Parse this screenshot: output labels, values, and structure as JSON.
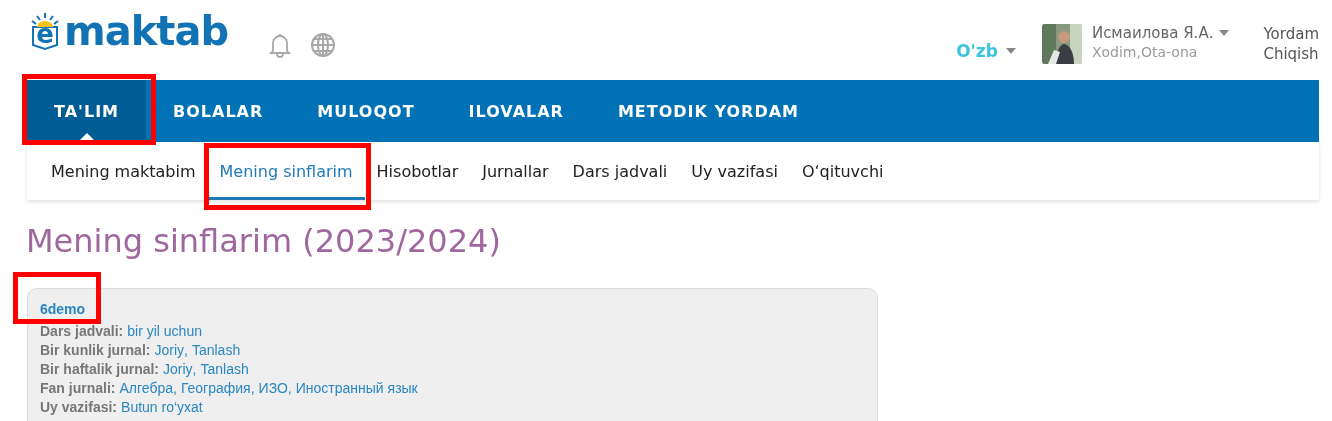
{
  "logo": {
    "letter": "e",
    "text": "maktab"
  },
  "header": {
    "language": "O'zb",
    "user": {
      "name": "Исмаилова Я.А.",
      "role": "Xodim,Ota-ona"
    },
    "links": [
      "Yordam",
      "Chiqish"
    ]
  },
  "nav": [
    {
      "label": "TA'LIM",
      "selected": true,
      "highlighted": true
    },
    {
      "label": "BOLALAR",
      "selected": false,
      "highlighted": false
    },
    {
      "label": "MULOQOT",
      "selected": false,
      "highlighted": false
    },
    {
      "label": "ILOVALAR",
      "selected": false,
      "highlighted": false
    },
    {
      "label": "METODIK YORDAM",
      "selected": false,
      "highlighted": false
    }
  ],
  "subnav": [
    {
      "label": "Mening maktabim",
      "selected": false,
      "highlighted": false
    },
    {
      "label": "Mening sinflarim",
      "selected": true,
      "highlighted": true
    },
    {
      "label": "Hisobotlar",
      "selected": false,
      "highlighted": false
    },
    {
      "label": "Jurnallar",
      "selected": false,
      "highlighted": false
    },
    {
      "label": "Dars jadvali",
      "selected": false,
      "highlighted": false
    },
    {
      "label": "Uy vazifasi",
      "selected": false,
      "highlighted": false
    },
    {
      "label": "O‘qituvchi",
      "selected": false,
      "highlighted": false
    }
  ],
  "page_title": "Mening sinflarim (2023/2024)",
  "class_card": {
    "name": "6demo",
    "highlighted": true,
    "separator": ",",
    "rows": [
      {
        "label": "Dars jadvali:",
        "links": [
          "bir yil uchun"
        ]
      },
      {
        "label": "Bir kunlik jurnal:",
        "links": [
          "Joriy",
          "Tanlash"
        ]
      },
      {
        "label": "Bir haftalik jurnal:",
        "links": [
          "Joriy",
          "Tanlash"
        ]
      },
      {
        "label": "Fan jurnali:",
        "links": [
          "Алгебра",
          "География",
          "ИЗО",
          "Иностранный язык"
        ]
      },
      {
        "label": "Uy vazifasi:",
        "links": [
          "Butun ro‘yxat"
        ]
      }
    ]
  }
}
